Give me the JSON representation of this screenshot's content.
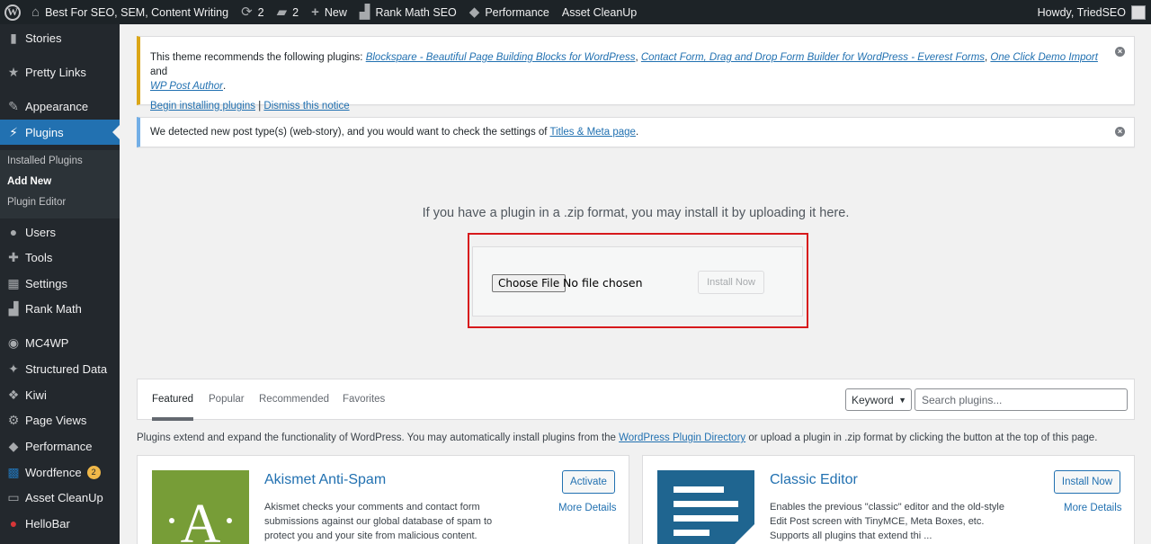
{
  "adminbar": {
    "site_name": "Best For SEO, SEM, Content Writing",
    "updates_count": "2",
    "comments_count": "2",
    "new_label": "New",
    "rank_math_label": "Rank Math SEO",
    "performance_label": "Performance",
    "asset_cleanup_label": "Asset CleanUp",
    "howdy": "Howdy, TriedSEO"
  },
  "sidebar": {
    "items": [
      {
        "label": "Stories",
        "icon": "stories-icon"
      },
      {
        "label": "Pretty Links",
        "icon": "star-icon"
      },
      {
        "label": "Appearance",
        "icon": "brush-icon"
      },
      {
        "label": "Plugins",
        "icon": "plug-icon"
      },
      {
        "label": "Users",
        "icon": "users-icon"
      },
      {
        "label": "Tools",
        "icon": "wrench-icon"
      },
      {
        "label": "Settings",
        "icon": "settings-icon"
      },
      {
        "label": "Rank Math",
        "icon": "chart-icon"
      },
      {
        "label": "MC4WP",
        "icon": "mc4wp-icon"
      },
      {
        "label": "Structured Data",
        "icon": "pin-icon"
      },
      {
        "label": "Kiwi",
        "icon": "share-icon"
      },
      {
        "label": "Page Views",
        "icon": "gear-icon"
      },
      {
        "label": "Performance",
        "icon": "performance-icon"
      },
      {
        "label": "Wordfence",
        "icon": "wordfence-icon",
        "badge": "2"
      },
      {
        "label": "Asset CleanUp",
        "icon": "asset-icon"
      },
      {
        "label": "HelloBar",
        "icon": "hellobar-icon"
      }
    ],
    "submenu": [
      "Installed Plugins",
      "Add New",
      "Plugin Editor"
    ]
  },
  "notice_theme": {
    "intro": "This theme recommends the following plugins: ",
    "plugin1": "Blockspare - Beautiful Page Building Blocks for WordPress",
    "sep1": ", ",
    "plugin2": "Contact Form, Drag and Drop Form Builder for WordPress - Everest Forms",
    "sep2": ", ",
    "plugin3": "One Click Demo Import",
    "and": " and",
    "plugin4": "WP Post Author",
    "period": ".",
    "begin_link": "Begin installing plugins",
    "pipe": " | ",
    "dismiss_link": "Dismiss this notice"
  },
  "notice_rankmath": {
    "text": "We detected new post type(s) (web-story), and you would want to check the settings of ",
    "link": "Titles & Meta page",
    "period": "."
  },
  "upload": {
    "instruction": "If you have a plugin in a .zip format, you may install it by uploading it here.",
    "choose_file": "Choose File",
    "no_file": "No file chosen",
    "install_now": "Install Now"
  },
  "filter": {
    "tabs": [
      "Featured",
      "Popular",
      "Recommended",
      "Favorites"
    ],
    "keyword": "Keyword",
    "search_placeholder": "Search plugins..."
  },
  "plugins_desc": {
    "before": "Plugins extend and expand the functionality of WordPress. You may automatically install plugins from the ",
    "link": "WordPress Plugin Directory",
    "after": " or upload a plugin in .zip format by clicking the button at the top of this page."
  },
  "cards": [
    {
      "name": "Akismet Anti-Spam",
      "description": "Akismet checks your comments and contact form submissions against our global database of spam to protect you and your site from malicious content.",
      "action": "Activate",
      "more": "More Details",
      "thumb_color": "#779d37"
    },
    {
      "name": "Classic Editor",
      "description": "Enables the previous \"classic\" editor and the old-style Edit Post screen with TinyMCE, Meta Boxes, etc. Supports all plugins that extend thi ...",
      "action": "Install Now",
      "more": "More Details",
      "thumb_color": "#1f6590"
    }
  ],
  "colors": {
    "adminbar_bg": "#1d2327",
    "sidebar_bg": "#23282d",
    "accent": "#2271b1",
    "notice_warning": "#dba617",
    "notice_info": "#72aee6",
    "highlight": "#d7191c"
  }
}
